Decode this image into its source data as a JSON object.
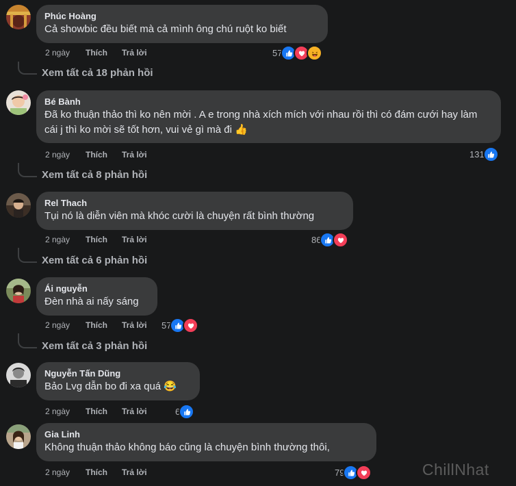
{
  "comments": [
    {
      "name": "Phúc Hoàng",
      "text": "Cả showbic đều biết mà cả mình ông chú ruột ko biết",
      "time": "2 ngày",
      "like": "Thích",
      "reply": "Trả lời",
      "reactions": "57",
      "reaction_icons": [
        "like-icon",
        "love-icon",
        "haha-icon"
      ],
      "see_replies": "Xem tất cả 18 phản hồi"
    },
    {
      "name": "Bé Bành",
      "text": "Đã ko thuận thảo thì ko nên mời . A e trong nhà xích mích với nhau rồi thì có đám cưới hay làm cái j thì ko mời sẽ tốt hơn, vui vẻ gì mà đi 👍",
      "time": "2 ngày",
      "like": "Thích",
      "reply": "Trả lời",
      "reactions": "131",
      "reaction_icons": [
        "like-icon"
      ],
      "see_replies": "Xem tất cả 8 phản hồi"
    },
    {
      "name": "Rel Thach",
      "text": "Tụi nó là diễn viên mà khóc cười là chuyện rất bình thường",
      "time": "2 ngày",
      "like": "Thích",
      "reply": "Trả lời",
      "reactions": "86",
      "reaction_icons": [
        "like-icon",
        "love-icon"
      ],
      "see_replies": "Xem tất cả 6 phản hồi"
    },
    {
      "name": "Ái nguyễn",
      "text": "Đèn nhà ai nấy sáng",
      "time": "2 ngày",
      "like": "Thích",
      "reply": "Trả lời",
      "reactions": "57",
      "reaction_icons": [
        "like-icon",
        "love-icon"
      ],
      "see_replies": "Xem tất cả 3 phản hồi"
    },
    {
      "name": "Nguyễn Tấn Dũng",
      "text": "Bảo Lvg dẫn bo đi xa quá 😂",
      "time": "2 ngày",
      "like": "Thích",
      "reply": "Trả lời",
      "reactions": "6",
      "reaction_icons": [
        "like-icon"
      ]
    },
    {
      "name": "Gia Linh",
      "text": "Không thuận thảo không báo cũng là chuyện bình thường thôi,",
      "time": "2 ngày",
      "like": "Thích",
      "reply": "Trả lời",
      "reactions": "79",
      "reaction_icons": [
        "like-icon",
        "love-icon"
      ]
    }
  ],
  "watermark": {
    "part1": "Chill",
    "part2": "Nhat"
  },
  "colors": {
    "background": "#18191a",
    "bubble": "#3a3b3c",
    "like": "#1877f2",
    "love": "#f33e58",
    "haha": "#f7b125"
  }
}
